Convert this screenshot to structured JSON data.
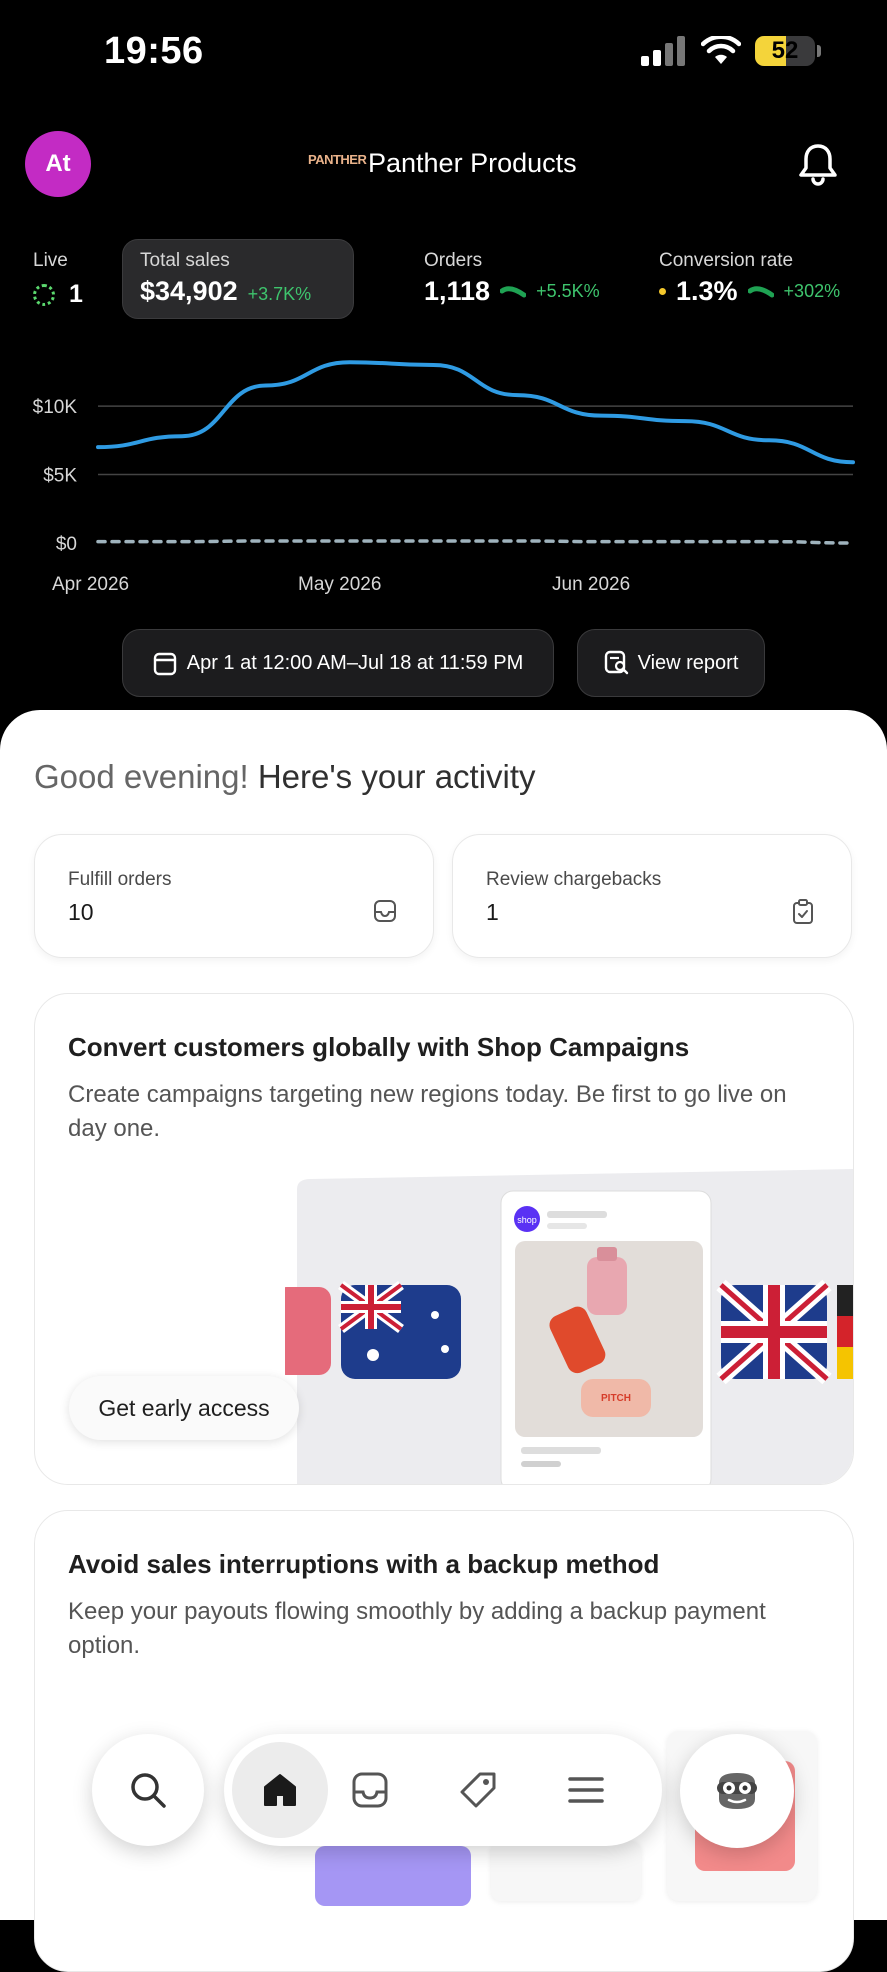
{
  "status_bar": {
    "time": "19:56",
    "battery": "52",
    "battery_level": 0.52
  },
  "header": {
    "avatar_initials": "At",
    "store_logo_text": "PANTHER",
    "store_name": "Panther Products"
  },
  "metrics": {
    "live": {
      "label": "Live",
      "value": "1"
    },
    "total_sales": {
      "label": "Total sales",
      "value": "$34,902",
      "delta": "+3.7K%"
    },
    "orders": {
      "label": "Orders",
      "value": "1,118",
      "delta": "+5.5K%"
    },
    "conversion": {
      "label": "Conversion rate",
      "value": "1.3%",
      "delta": "+302%"
    }
  },
  "chart_data": {
    "type": "line",
    "x_ticks": [
      "Apr 2026",
      "May 2026",
      "Jun 2026"
    ],
    "y_ticks": [
      "$10K",
      "$5K",
      "$0"
    ],
    "ylim": [
      0,
      13000
    ],
    "series": [
      {
        "values": [
          7000,
          7800,
          11500,
          13200,
          13000,
          10800,
          9300,
          8900,
          7500,
          5900
        ]
      },
      {
        "values": [
          100,
          100,
          150,
          150,
          150,
          150,
          100,
          100,
          100,
          0
        ]
      }
    ],
    "colors": [
      "#2f9be3",
      "#9fb3bd"
    ]
  },
  "date_range": {
    "label": "Apr 1 at 12:00 AM–Jul 18 at 11:59 PM"
  },
  "view_report": {
    "label": "View report"
  },
  "greeting": {
    "prefix": "Good evening!",
    "suffix": "Here's your activity"
  },
  "tasks": [
    {
      "label": "Fulfill orders",
      "value": "10"
    },
    {
      "label": "Review chargebacks",
      "value": "1"
    }
  ],
  "promo1": {
    "title": "Convert customers globally with Shop Campaigns",
    "description": "Create campaigns targeting new regions today. Be first to go live on day one.",
    "button": "Get early access",
    "bottle_brand": "PITCH",
    "shop_badge": "shop"
  },
  "promo2": {
    "title": "Avoid sales interruptions with a backup method",
    "description": "Keep your payouts flowing smoothly by adding a backup payment option."
  }
}
